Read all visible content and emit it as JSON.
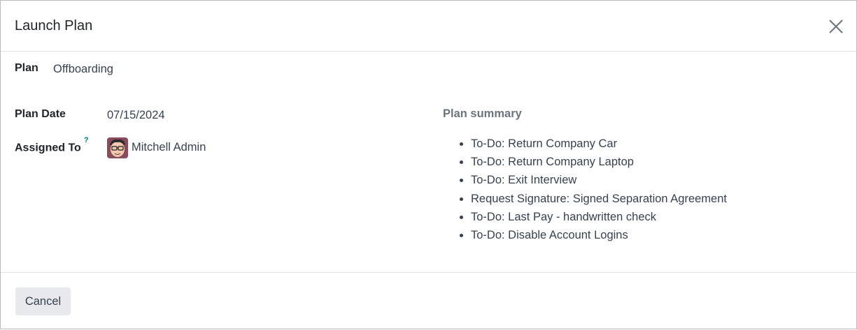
{
  "dialog": {
    "title": "Launch Plan",
    "close_icon": "close-icon"
  },
  "form": {
    "plan_label": "Plan",
    "plan_value": "Offboarding",
    "plan_date_label": "Plan Date",
    "plan_date_value": "07/15/2024",
    "assigned_to_label": "Assigned To",
    "assigned_to_help": "?",
    "assigned_to_value": "Mitchell Admin",
    "avatar_icon": "user-avatar-icon"
  },
  "summary": {
    "title": "Plan summary",
    "items": [
      "To-Do: Return Company Car",
      "To-Do: Return Company Laptop",
      "To-Do: Exit Interview",
      "Request Signature: Signed Separation Agreement",
      "To-Do: Last Pay - handwritten check",
      "To-Do: Disable Account Logins"
    ]
  },
  "footer": {
    "cancel_label": "Cancel"
  }
}
